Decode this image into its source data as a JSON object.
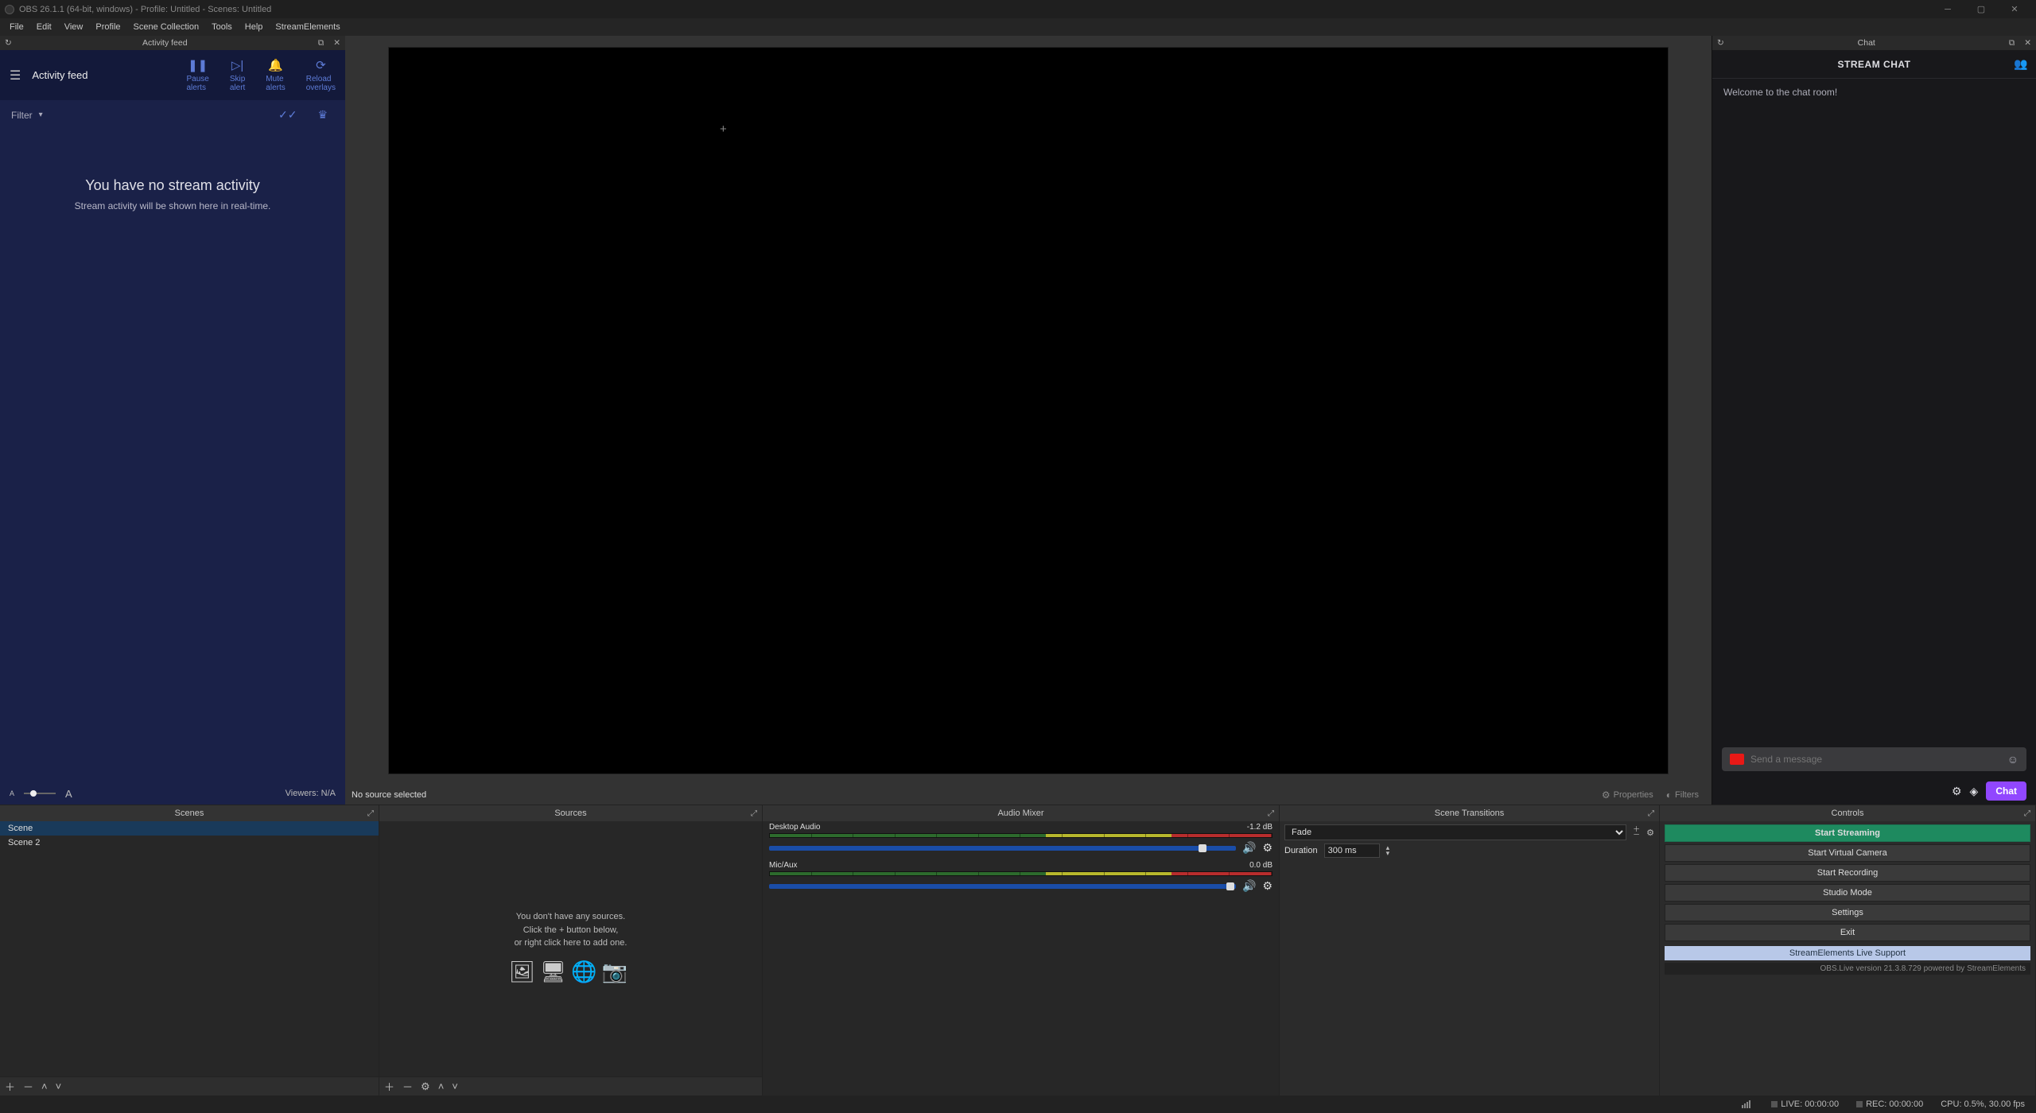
{
  "titlebar": {
    "text": "OBS 26.1.1 (64-bit, windows) - Profile: Untitled - Scenes: Untitled"
  },
  "menubar": {
    "items": [
      "File",
      "Edit",
      "View",
      "Profile",
      "Scene Collection",
      "Tools",
      "Help",
      "StreamElements"
    ]
  },
  "activity": {
    "dock_title": "Activity feed",
    "header_title": "Activity feed",
    "action_pause": "Pause\nalerts",
    "action_skip": "Skip\nalert",
    "action_mute": "Mute\nalerts",
    "action_reload": "Reload\noverlays",
    "filter_label": "Filter",
    "empty_big": "You have no stream activity",
    "empty_small": "Stream activity will be shown here in real-time.",
    "viewers_label": "Viewers: N/A"
  },
  "source_toolbar": {
    "no_source": "No source selected",
    "properties": "Properties",
    "filters": "Filters"
  },
  "chat": {
    "dock_title": "Chat",
    "header": "STREAM CHAT",
    "welcome": "Welcome to the chat room!",
    "placeholder": "Send a message",
    "chat_button": "Chat"
  },
  "panels": {
    "scenes_title": "Scenes",
    "sources_title": "Sources",
    "mixer_title": "Audio Mixer",
    "transitions_title": "Scene Transitions",
    "controls_title": "Controls"
  },
  "scenes": {
    "items": [
      "Scene",
      "Scene 2"
    ],
    "selected": 0
  },
  "sources": {
    "empty_line1": "You don't have any sources.",
    "empty_line2": "Click the + button below,",
    "empty_line3": "or right click here to add one."
  },
  "audio": {
    "tracks": [
      {
        "name": "Desktop Audio",
        "db": "-1.2 dB",
        "knob_pct": 92
      },
      {
        "name": "Mic/Aux",
        "db": "0.0 dB",
        "knob_pct": 98
      }
    ]
  },
  "transitions": {
    "selected": "Fade",
    "duration_label": "Duration",
    "duration_value": "300 ms"
  },
  "controls": {
    "start_streaming": "Start Streaming",
    "start_virtual": "Start Virtual Camera",
    "start_recording": "Start Recording",
    "studio_mode": "Studio Mode",
    "settings": "Settings",
    "exit": "Exit",
    "se_support": "StreamElements Live Support",
    "se_version": "OBS.Live version 21.3.8.729 powered by StreamElements"
  },
  "statusbar": {
    "live": "LIVE: 00:00:00",
    "rec": "REC: 00:00:00",
    "cpu": "CPU: 0.5%, 30.00 fps"
  }
}
